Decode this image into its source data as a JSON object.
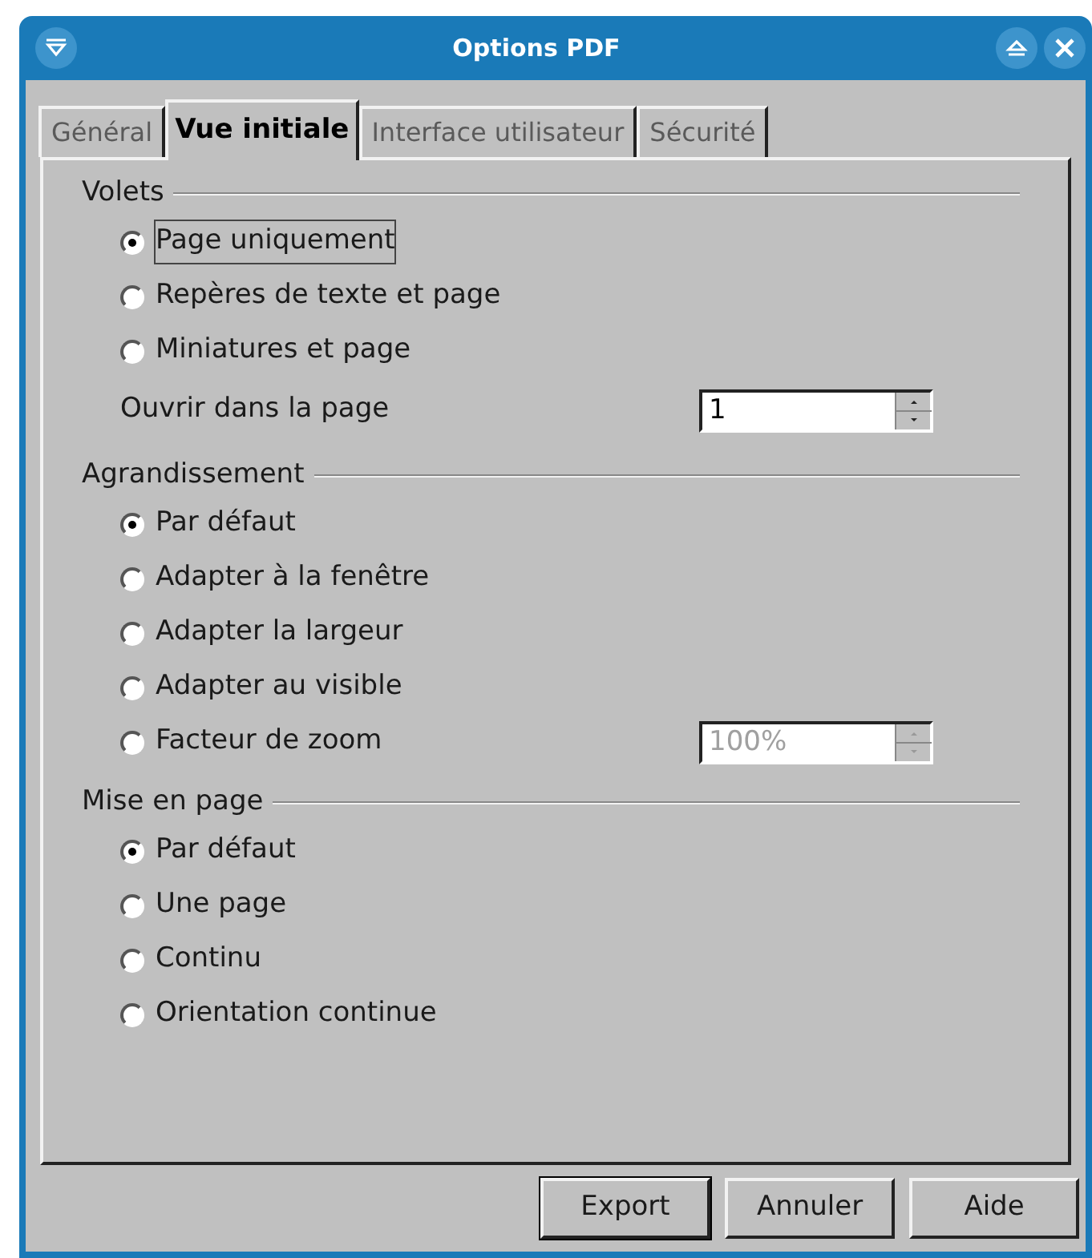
{
  "window": {
    "title": "Options PDF"
  },
  "tabs": [
    {
      "label": "Général",
      "selected": false
    },
    {
      "label": "Vue initiale",
      "selected": true
    },
    {
      "label": "Interface utilisateur",
      "selected": false
    },
    {
      "label": "Sécurité",
      "selected": false
    }
  ],
  "groups": [
    {
      "title": "Volets",
      "options": [
        {
          "label": "Page uniquement",
          "selected": true
        },
        {
          "label": "Repères de texte et page",
          "selected": false
        },
        {
          "label": "Miniatures et page",
          "selected": false
        }
      ],
      "field": {
        "label": "Ouvrir dans la page",
        "value": "1",
        "disabled": false
      }
    },
    {
      "title": "Agrandissement",
      "options": [
        {
          "label": "Par défaut",
          "selected": true
        },
        {
          "label": "Adapter à la fenêtre",
          "selected": false
        },
        {
          "label": "Adapter la largeur",
          "selected": false
        },
        {
          "label": "Adapter au visible",
          "selected": false
        },
        {
          "label": "Facteur de zoom",
          "selected": false
        }
      ],
      "field": {
        "value": "100%",
        "disabled": true
      }
    },
    {
      "title": "Mise en page",
      "options": [
        {
          "label": "Par défaut",
          "selected": true
        },
        {
          "label": "Une page",
          "selected": false
        },
        {
          "label": "Continu",
          "selected": false
        },
        {
          "label": "Orientation continue",
          "selected": false
        }
      ]
    }
  ],
  "buttons": [
    {
      "label": "Export",
      "default": true
    },
    {
      "label": "Annuler",
      "default": false
    },
    {
      "label": "Aide",
      "default": false
    }
  ]
}
